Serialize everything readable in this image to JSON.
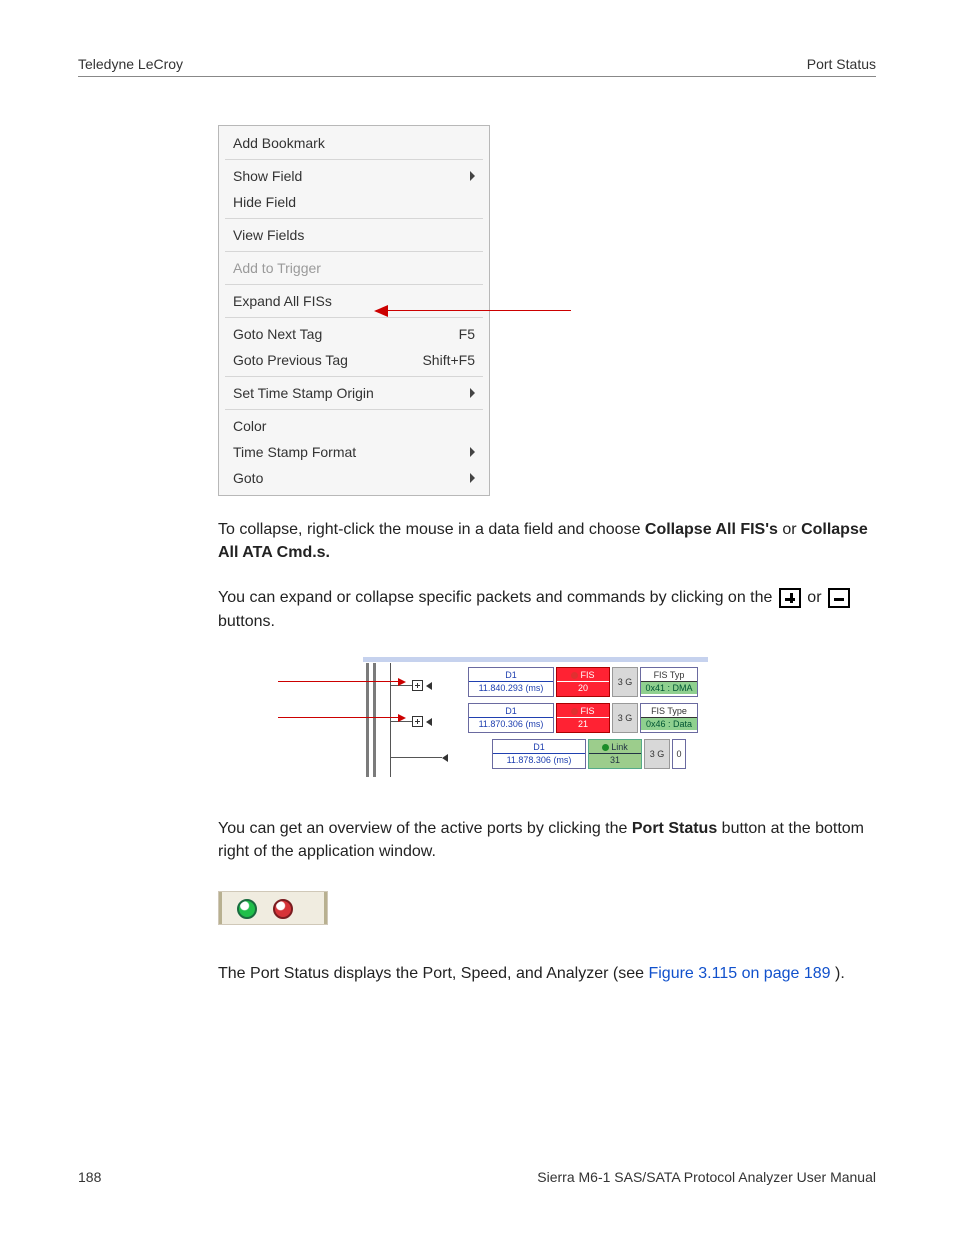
{
  "header": {
    "left": "Teledyne LeCroy",
    "right": "Port Status"
  },
  "menu": {
    "addBookmark": "Add Bookmark",
    "showField": "Show Field",
    "hideField": "Hide Field",
    "viewFields": "View Fields",
    "addToTrigger": "Add to Trigger",
    "expandAllFISs": "Expand All FISs",
    "gotoNextTag": {
      "label": "Goto Next Tag",
      "short": "F5"
    },
    "gotoPrevTag": {
      "label": "Goto Previous Tag",
      "short": "Shift+F5"
    },
    "setTimeOrigin": "Set Time Stamp Origin",
    "color": "Color",
    "timeFormat": "Time Stamp Format",
    "goto": "Goto"
  },
  "para": {
    "collapse_pre": "To collapse, right-click the mouse in a data field and choose ",
    "collapse_b1": "Collapse All FIS's",
    "collapse_mid": " or ",
    "collapse_b2": "Collapse All ATA Cmd.s.",
    "expand_pre": "You can expand or collapse specific packets and commands by clicking on the ",
    "expand_mid": " or ",
    "expand_post": " buttons.",
    "overview_pre": "You can get an overview of the active ports by clicking the ",
    "overview_b": "Port Status",
    "overview_post": " button at the bottom right of the application window.",
    "portstatus_pre": "The Port Status displays the Port, Speed, and Analyzer (see ",
    "portstatus_link": "Figure 3.115 on page 189",
    "portstatus_post": ")."
  },
  "packets": {
    "r1": {
      "dev": "D1",
      "ts": "11.840.293 (ms)",
      "kind": "FIS",
      "idx": "20",
      "spd": "3 G",
      "typeH": "FIS Typ",
      "typeV": "0x41 : DMA"
    },
    "r2": {
      "dev": "D1",
      "ts": "11.870.306 (ms)",
      "kind": "FIS",
      "idx": "21",
      "spd": "3 G",
      "typeH": "FIS Type",
      "typeV": "0x46 : Data"
    },
    "r3": {
      "dev": "D1",
      "ts": "11.878.306 (ms)",
      "kind": "Link",
      "idx": "31",
      "spd": "3 G",
      "typeV": "0"
    }
  },
  "footer": {
    "page": "188",
    "title": "Sierra M6-1 SAS/SATA Protocol Analyzer User Manual"
  }
}
